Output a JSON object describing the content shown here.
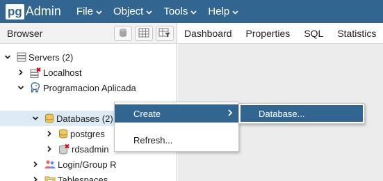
{
  "app": {
    "logo_pg": "pg",
    "logo_admin": "Admin",
    "brand_color": "#326690"
  },
  "menubar": {
    "items": [
      {
        "label": "File"
      },
      {
        "label": "Object"
      },
      {
        "label": "Tools"
      },
      {
        "label": "Help"
      }
    ]
  },
  "browser": {
    "title": "Browser",
    "tree": {
      "servers": "Servers (2)",
      "localhost": "Localhost",
      "server_group": "Programacion Aplicada",
      "databases": "Databases (2)",
      "db1": "postgres",
      "db2": "rdsadmin",
      "login_roles": "Login/Group R",
      "tablespaces": "Tablespaces"
    }
  },
  "tabs": [
    {
      "label": "Dashboard"
    },
    {
      "label": "Properties"
    },
    {
      "label": "SQL"
    },
    {
      "label": "Statistics"
    }
  ],
  "context_menu": {
    "create": "Create",
    "refresh": "Refresh...",
    "submenu": {
      "database": "Database..."
    }
  }
}
